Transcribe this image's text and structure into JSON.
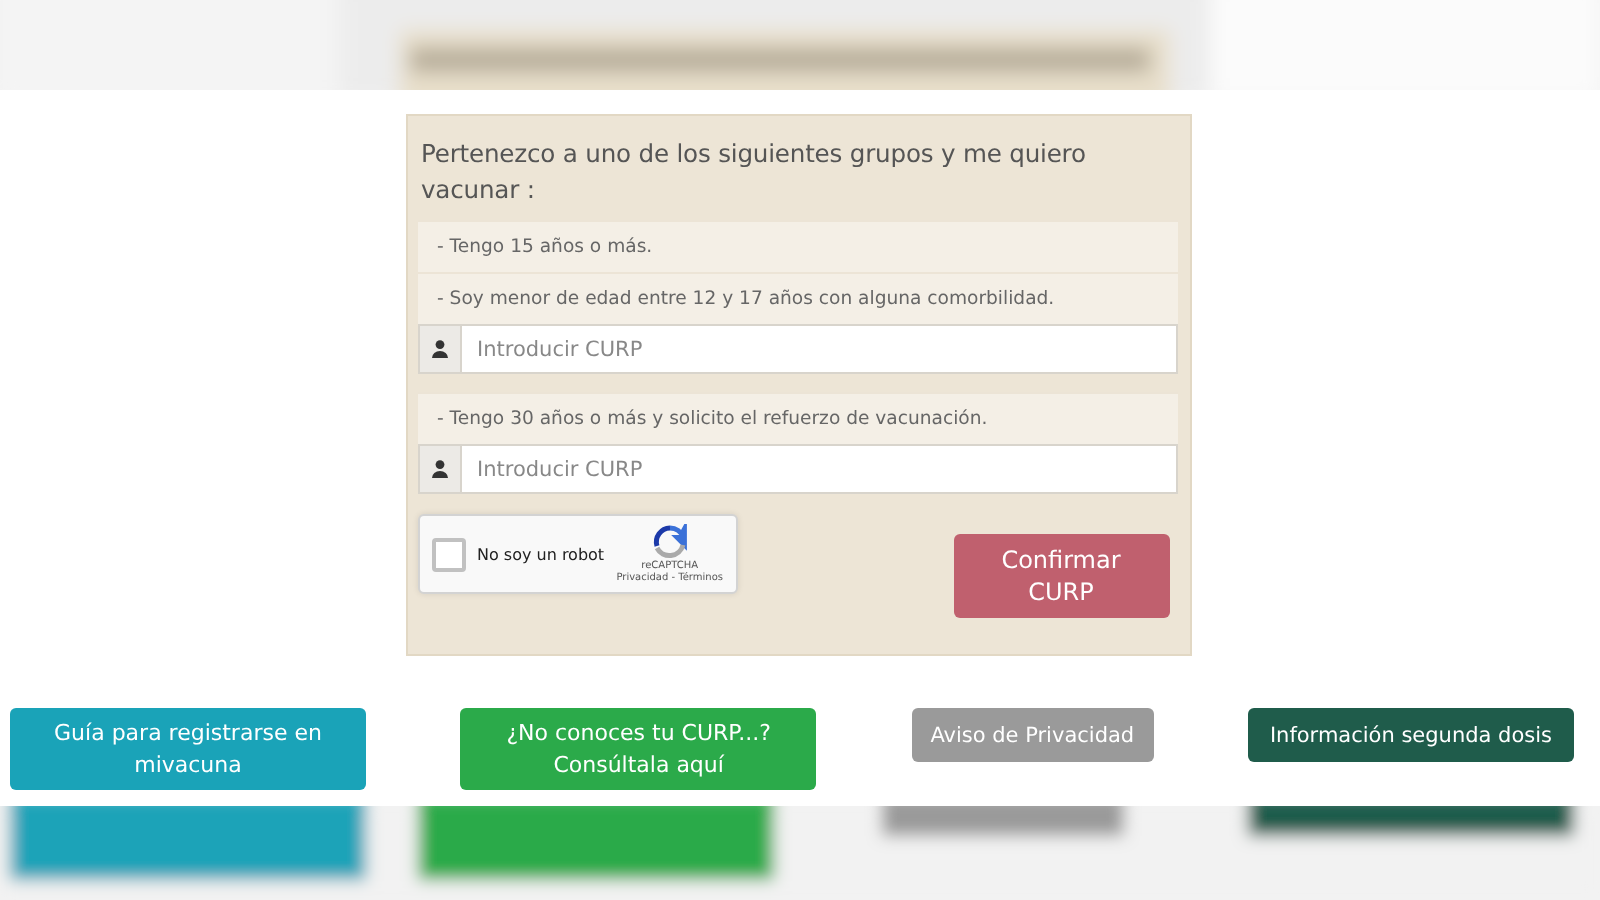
{
  "form": {
    "title": "Pertenezco a uno de los siguientes grupos y me quiero vacunar :",
    "groups": [
      {
        "label": "- Tengo 15 años o más."
      },
      {
        "label": "- Soy menor de edad entre 12 y 17 años con alguna comorbilidad.",
        "field": {
          "placeholder": "Introducir CURP"
        }
      },
      {
        "label": "- Tengo 30 años o más y solicito el refuerzo de vacunación.",
        "field": {
          "placeholder": "Introducir CURP"
        }
      }
    ],
    "captcha": {
      "label": "No soy un robot",
      "checked": false,
      "brand": "reCAPTCHA",
      "links": "Privacidad - Términos"
    },
    "confirm_button": "Confirmar CURP"
  },
  "buttons": [
    {
      "label": "Guía para registrarse en mivacuna",
      "color": "#1aa3b8"
    },
    {
      "label": "¿No conoces tu CURP...? Consúltala aquí",
      "color": "#2baa4a"
    },
    {
      "label": "Aviso de Privacidad",
      "color": "#9a9a9a"
    },
    {
      "label": "Información segunda dosis",
      "color": "#1f5c4b"
    }
  ]
}
